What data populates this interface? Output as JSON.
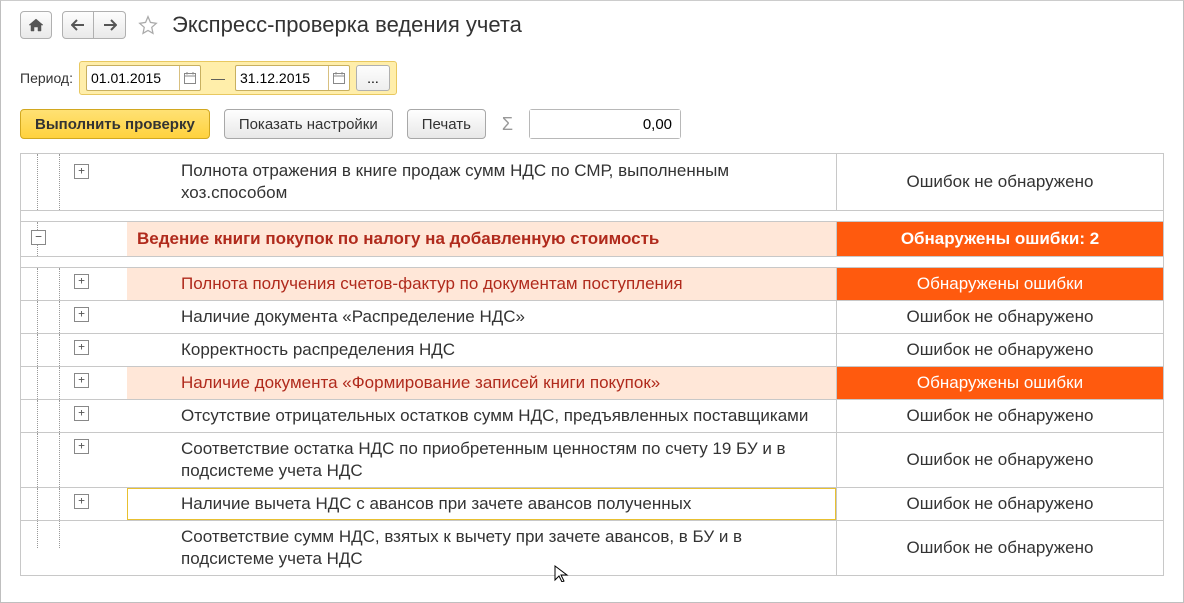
{
  "title": "Экспресс-проверка ведения учета",
  "period": {
    "label": "Период:",
    "from": "01.01.2015",
    "to": "31.12.2015",
    "dash": "—"
  },
  "toolbar": {
    "run": "Выполнить проверку",
    "settings": "Показать настройки",
    "print": "Печать",
    "sum_value": "0,00"
  },
  "status_ok": "Ошибок не обнаружено",
  "status_err": "Обнаружены ошибки",
  "rows": {
    "r0": {
      "text": "Полнота отражения в книге продаж сумм НДС по СМР, выполненным хоз.способом"
    },
    "section": {
      "text": "Ведение книги покупок по налогу на добавленную стоимость",
      "status": "Обнаружены ошибки: 2"
    },
    "r1": {
      "text": "Полнота получения счетов-фактур по документам поступления"
    },
    "r2": {
      "text": "Наличие документа «Распределение НДС»"
    },
    "r3": {
      "text": "Корректность распределения НДС"
    },
    "r4": {
      "text": "Наличие документа «Формирование записей книги покупок»"
    },
    "r5": {
      "text": "Отсутствие отрицательных остатков сумм НДС, предъявленных поставщиками"
    },
    "r6": {
      "text": "Соответствие остатка НДС по приобретенным ценностям по счету 19 БУ и в подсистеме учета НДС"
    },
    "r7": {
      "text": "Наличие вычета НДС с авансов при зачете авансов полученных"
    },
    "r8": {
      "text": "Соответствие сумм НДС, взятых к вычету при зачете авансов, в БУ и в подсистеме учета НДС"
    }
  },
  "icons": {
    "ellipsis": "..."
  }
}
